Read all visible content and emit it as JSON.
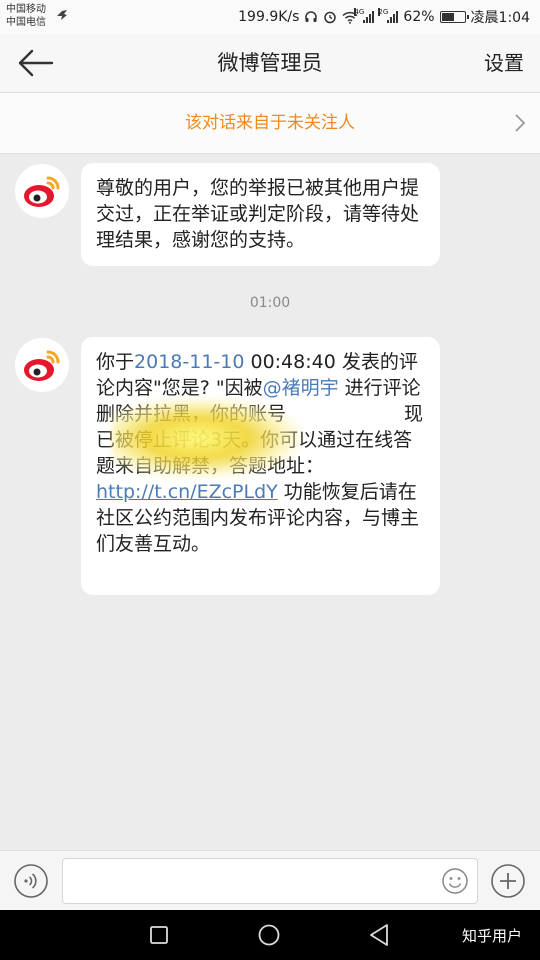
{
  "status_bar": {
    "carrier_1": "中国移动",
    "carrier_2": "中国电信",
    "speed": "199.9K/s",
    "network_1": "4G",
    "network_2": "2G",
    "battery_percent": 62,
    "battery_label": "62%",
    "time": "凌晨1:04"
  },
  "header": {
    "title": "微博管理员",
    "settings_label": "设置"
  },
  "notice": {
    "text": "该对话来自于未关注人"
  },
  "messages": {
    "first": {
      "text": "尊敬的用户，您的举报已被其他用户提交过，正在举证或判定阶段，请等待处理结果，感谢您的支持。"
    },
    "timestamp": "01:00",
    "second": {
      "part1": "你于",
      "date_link": "2018-11-10",
      "part2": " 00:48:40 发表的评论内容\"您是? \"因被",
      "mention": "@褚明宇",
      "part3": " 进行评论删除并拉黑，你的账号",
      "part4": "现已被停止评论3天。你可以通过在线答题来自助解禁，答题地址：",
      "url": "http://t.cn/EZcPLdY",
      "part5": " 功能恢复后请在社区公约范围内发布评论内容，与博主们友善互动。"
    }
  },
  "input": {
    "placeholder": "",
    "value": ""
  },
  "watermark": "知乎用户",
  "colors": {
    "accent_orange": "#f08a1d",
    "link_blue": "#4b7bb5",
    "weibo_red": "#e6162d"
  }
}
